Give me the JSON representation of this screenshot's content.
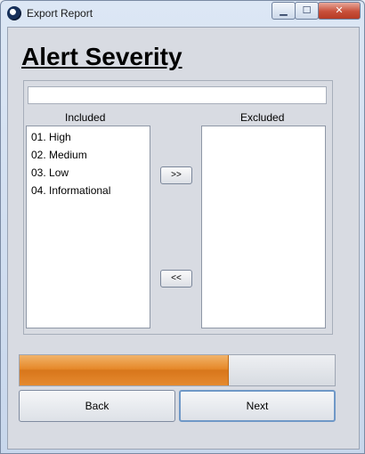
{
  "window": {
    "title": "Export Report",
    "min_glyph": "▁",
    "max_glyph": "☐",
    "close_glyph": "✕"
  },
  "page": {
    "heading": "Alert Severity"
  },
  "filter": {
    "value": ""
  },
  "included": {
    "label": "Included",
    "items": [
      "01. High",
      "02. Medium",
      "03. Low",
      "04. Informational"
    ]
  },
  "excluded": {
    "label": "Excluded",
    "items": []
  },
  "buttons": {
    "move_right": ">>",
    "move_left": "<<",
    "back": "Back",
    "next": "Next"
  },
  "progress": {
    "fraction": 0.66
  }
}
